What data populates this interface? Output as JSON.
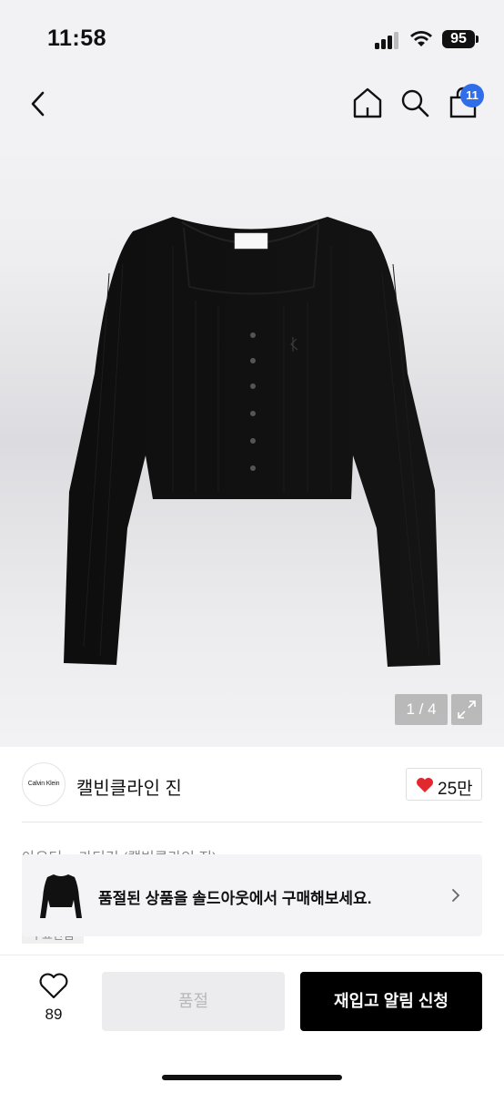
{
  "status_bar": {
    "time": "11:58",
    "battery": "95"
  },
  "nav": {
    "back_icon": "chevron-left-icon",
    "home_icon": "home-icon",
    "search_icon": "search-icon",
    "cart_icon": "shopping-bag-icon",
    "cart_badge": "11",
    "badge_color": "#2f6ee8"
  },
  "gallery": {
    "counter": "1 / 4",
    "expand_icon": "expand-icon"
  },
  "brand": {
    "logo_text": "Calvin Klein",
    "name": "캘빈클라인 진",
    "like_count": "25만",
    "heart_color": "#e0282e"
  },
  "breadcrumb": "아우터 > 가디건 (캘빈클라인 진)",
  "hidden_tag": "무료반품",
  "soldout_banner": {
    "text": "품절된 상품을 솔드아웃에서 구매해보세요.",
    "arrow_icon": "chevron-right-icon"
  },
  "bottom_bar": {
    "wish_icon": "heart-outline-icon",
    "wish_count": "89",
    "soldout_label": "품절",
    "restock_label": "재입고 알림 신청"
  }
}
